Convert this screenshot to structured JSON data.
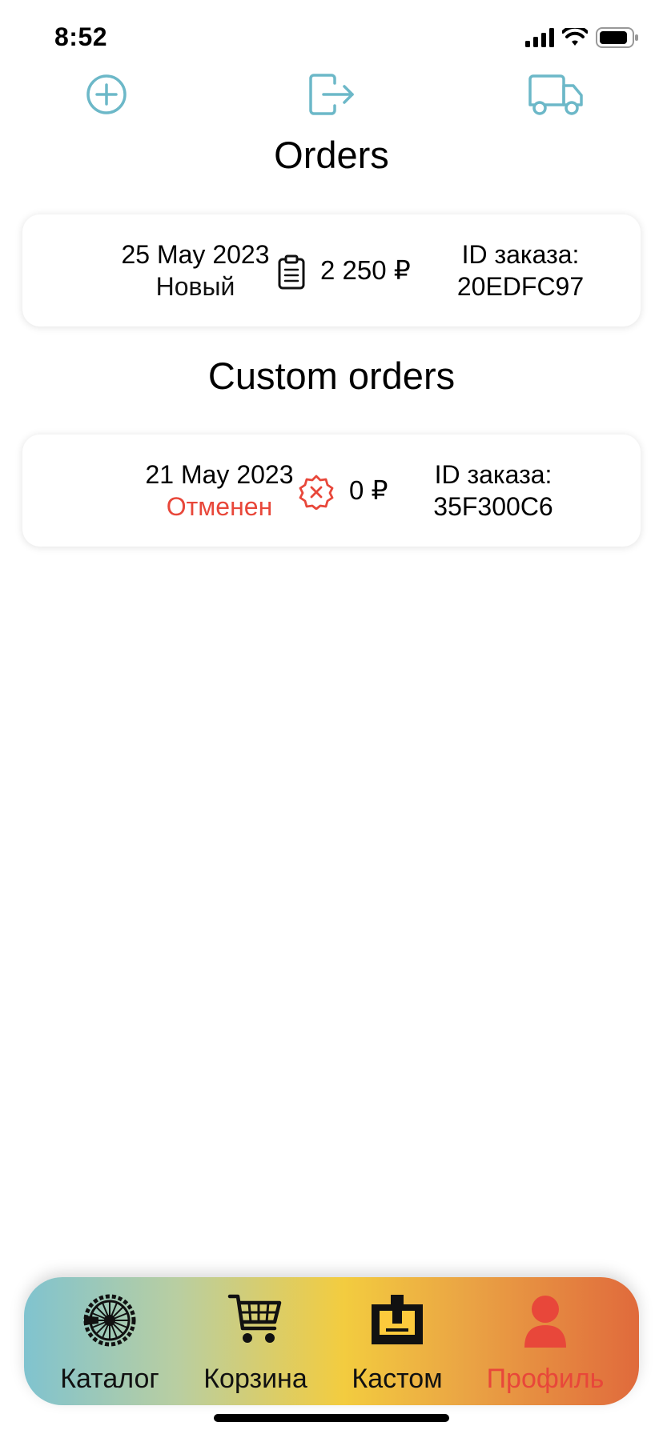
{
  "status_bar": {
    "time": "8:52"
  },
  "top_actions": {
    "add_icon": "plus-circle-icon",
    "exit_icon": "logout-icon",
    "delivery_icon": "truck-icon",
    "accent_color": "#6cb8c8"
  },
  "orders": {
    "title": "Orders",
    "items": [
      {
        "date": "25 May 2023",
        "status": "Новый",
        "status_icon": "clipboard-icon",
        "amount": "2 250 ₽",
        "id_label": "ID заказа:",
        "id_value": "20EDFC97"
      }
    ]
  },
  "custom_orders": {
    "title": "Custom orders",
    "items": [
      {
        "date": "21 May 2023",
        "status": "Отменен",
        "status_icon": "cancel-badge-icon",
        "status_color": "#e8473a",
        "amount": "0 ₽",
        "id_label": "ID заказа:",
        "id_value": "35F300C6"
      }
    ]
  },
  "tab_bar": {
    "tabs": [
      {
        "label": "Каталог",
        "icon": "bike-wheel-icon"
      },
      {
        "label": "Корзина",
        "icon": "cart-icon"
      },
      {
        "label": "Кастом",
        "icon": "box-icon"
      },
      {
        "label": "Профиль",
        "icon": "person-icon",
        "active": true
      }
    ],
    "active_color": "#e8473a"
  }
}
